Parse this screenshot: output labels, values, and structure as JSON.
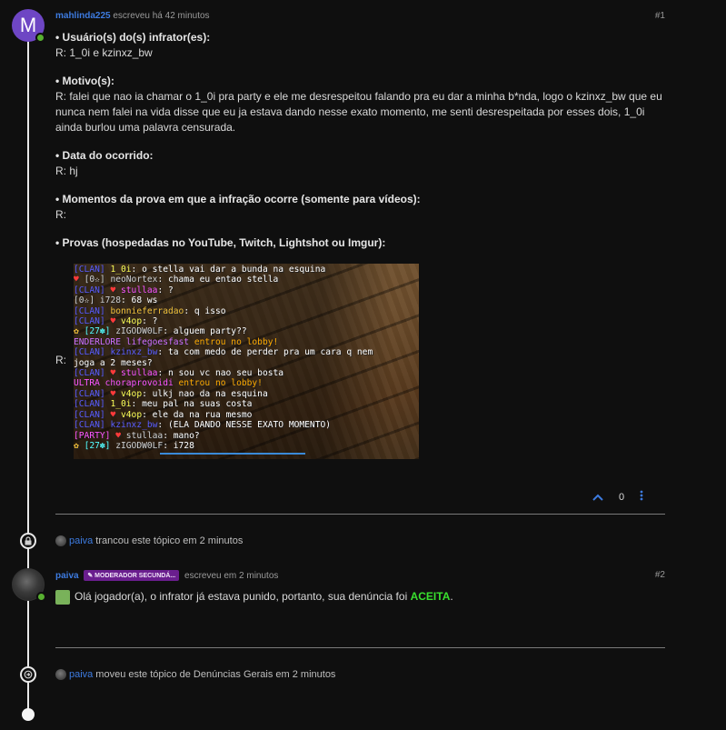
{
  "post1": {
    "avatar_letter": "M",
    "username": "mahlinda225",
    "meta": "escreveu há 42 minutos",
    "number": "#1",
    "sections": [
      {
        "label": "• Usuário(s) do(s) infrator(es):",
        "answer": "R: 1_0i e kzinxz_bw"
      },
      {
        "label": "• Motivo(s):",
        "answer": "R: falei que nao ia chamar o 1_0i pra party e ele me desrespeitou falando pra eu dar a minha b*nda, logo o kzinxz_bw que eu nunca nem falei na vida disse que eu ja estava dando nesse exato momento, me senti desrespeitada por esses dois, 1_0i ainda burlou uma palavra censurada."
      },
      {
        "label": "• Data do ocorrido:",
        "answer": "R: hj"
      },
      {
        "label": "• Momentos da prova em que a infração ocorre (somente para vídeos):",
        "answer": "R:"
      },
      {
        "label": "• Provas (hospedadas no YouTube, Twitch, Lightshot ou Imgur):",
        "answer": "R:"
      }
    ],
    "like_count": "0",
    "chat": [
      [
        {
          "t": "[CLAN] ",
          "c": "c-clan"
        },
        {
          "t": "1_0i",
          "c": "c-yellow"
        },
        {
          "t": ": o stella vai dar a bunda na esquina",
          "c": ""
        }
      ],
      [
        {
          "t": "♥ ",
          "c": "c-heart"
        },
        {
          "t": "[0✫] ",
          "c": "c-gray"
        },
        {
          "t": "neoNortex",
          "c": "c-gray"
        },
        {
          "t": ": chama eu entao stella",
          "c": ""
        }
      ],
      [
        {
          "t": "[CLAN] ",
          "c": "c-clan"
        },
        {
          "t": "♥ ",
          "c": "c-heart"
        },
        {
          "t": "stullaa",
          "c": "c-pink"
        },
        {
          "t": ": ?",
          "c": ""
        }
      ],
      [
        {
          "t": "[0✫] ",
          "c": "c-gray"
        },
        {
          "t": "i728",
          "c": "c-gray"
        },
        {
          "t": ": 68 ws",
          "c": ""
        }
      ],
      [
        {
          "t": "[CLAN] ",
          "c": "c-clan"
        },
        {
          "t": "bonnieferradao",
          "c": "c-gold"
        },
        {
          "t": ": q isso",
          "c": ""
        }
      ],
      [
        {
          "t": "[CLAN] ",
          "c": "c-clan"
        },
        {
          "t": "♥ ",
          "c": "c-heart"
        },
        {
          "t": "v4op",
          "c": "c-lime"
        },
        {
          "t": ": ?",
          "c": ""
        }
      ],
      [
        {
          "t": "✿ ",
          "c": "c-gold"
        },
        {
          "t": "[27✽] ",
          "c": "c-aqua"
        },
        {
          "t": "zIGODW0LF",
          "c": "c-gray"
        },
        {
          "t": ": alguem party??",
          "c": ""
        }
      ],
      [
        {
          "t": "ENDERLORE ",
          "c": "c-purple"
        },
        {
          "t": "lifegoesfast ",
          "c": "c-purple"
        },
        {
          "t": "entrou no lobby!",
          "c": "c-orange"
        }
      ],
      [
        {
          "t": "[CLAN] ",
          "c": "c-clan"
        },
        {
          "t": "kzinxz_bw",
          "c": "c-clan"
        },
        {
          "t": ": ta com medo de perder pra um cara q nem",
          "c": ""
        }
      ],
      [
        {
          "t": " joga a 2 meses?",
          "c": ""
        }
      ],
      [
        {
          "t": "[CLAN] ",
          "c": "c-clan"
        },
        {
          "t": "♥ ",
          "c": "c-heart"
        },
        {
          "t": "stullaa",
          "c": "c-pink"
        },
        {
          "t": ": n sou vc nao seu bosta",
          "c": ""
        }
      ],
      [
        {
          "t": "ULTRA ",
          "c": "c-pink"
        },
        {
          "t": "choraprovoidi ",
          "c": "c-pink"
        },
        {
          "t": "entrou no lobby!",
          "c": "c-orange"
        }
      ],
      [
        {
          "t": "[CLAN] ",
          "c": "c-clan"
        },
        {
          "t": "♥ ",
          "c": "c-heart"
        },
        {
          "t": "v4op",
          "c": "c-lime"
        },
        {
          "t": ": ulkj nao da na esquina",
          "c": ""
        }
      ],
      [
        {
          "t": "[CLAN] ",
          "c": "c-clan"
        },
        {
          "t": "1_0i",
          "c": "c-yellow"
        },
        {
          "t": ": meu pal na suas costa",
          "c": ""
        }
      ],
      [
        {
          "t": "[CLAN] ",
          "c": "c-clan"
        },
        {
          "t": "♥ ",
          "c": "c-heart"
        },
        {
          "t": "v4op",
          "c": "c-lime"
        },
        {
          "t": ": ele da na rua mesmo",
          "c": ""
        }
      ],
      [
        {
          "t": "[CLAN] ",
          "c": "c-clan"
        },
        {
          "t": "kzinxz_bw",
          "c": "c-clan"
        },
        {
          "t": ": (ELA DANDO NESSE EXATO MOMENTO)",
          "c": ""
        }
      ],
      [
        {
          "t": "[PARTY] ",
          "c": "c-pink"
        },
        {
          "t": "♥ ",
          "c": "c-heart"
        },
        {
          "t": "stullaa",
          "c": "c-gray"
        },
        {
          "t": ": mano?",
          "c": ""
        }
      ],
      [
        {
          "t": "✿ ",
          "c": "c-gold"
        },
        {
          "t": "[27✽] ",
          "c": "c-aqua"
        },
        {
          "t": "zIGODW0LF",
          "c": "c-gray"
        },
        {
          "t": ": i728",
          "c": ""
        }
      ]
    ]
  },
  "event1": {
    "user": "paiva",
    "text": "trancou este tópico em 2 minutos"
  },
  "post2": {
    "username": "paiva",
    "badge": "MODERADOR SECUNDÁ...",
    "meta": "escreveu em 2 minutos",
    "number": "#2",
    "text_before": "Olá jogador(a), o infrator já estava punido, portanto, sua denúncia foi",
    "accepted": "ACEITA",
    "text_after": "."
  },
  "event2": {
    "user": "paiva",
    "text": "moveu este tópico de Denúncias Gerais em 2 minutos"
  },
  "colors": {
    "link": "#3d7be0",
    "accent_green": "#39e02e",
    "avatar_purple": "#6e46c4",
    "badge_purple": "#6a1e8e",
    "online": "#58b030"
  }
}
